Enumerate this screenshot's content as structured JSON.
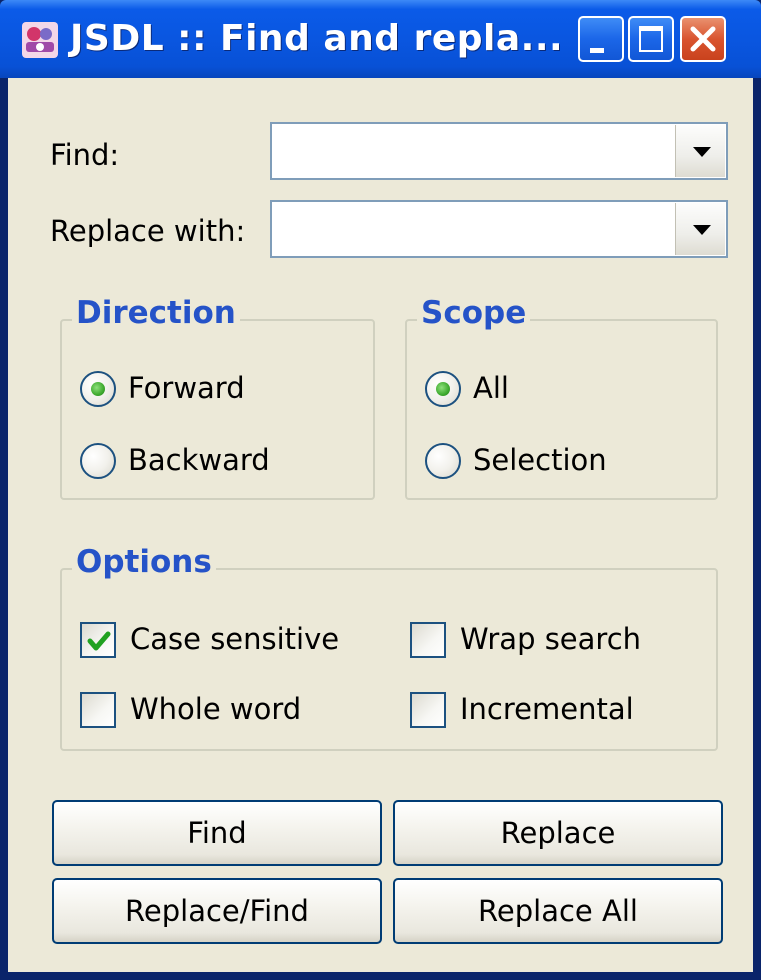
{
  "window": {
    "title": "JSDL :: Find and repla...",
    "buttons": {
      "minimize": "minimize",
      "maximize": "maximize",
      "close": "close"
    }
  },
  "form": {
    "find_label": "Find:",
    "find_value": "",
    "replace_label": "Replace with:",
    "replace_value": ""
  },
  "direction": {
    "title": "Direction",
    "options": [
      {
        "label": "Forward",
        "selected": true
      },
      {
        "label": "Backward",
        "selected": false
      }
    ]
  },
  "scope": {
    "title": "Scope",
    "options": [
      {
        "label": "All",
        "selected": true
      },
      {
        "label": "Selection",
        "selected": false
      }
    ]
  },
  "options": {
    "title": "Options",
    "items": [
      {
        "label": "Case sensitive",
        "checked": true
      },
      {
        "label": "Wrap search",
        "checked": false
      },
      {
        "label": "Whole word",
        "checked": false
      },
      {
        "label": "Incremental",
        "checked": false
      }
    ]
  },
  "actions": {
    "find": "Find",
    "replace": "Replace",
    "replace_find": "Replace/Find",
    "replace_all": "Replace All"
  },
  "colors": {
    "titlebar": "#0a56e0",
    "client_bg": "#ece9d8",
    "group_title": "#2553c8",
    "radio_selected": "#3eaa2f",
    "check_mark": "#21a121",
    "close_button": "#d9542f"
  },
  "icons": {
    "app": "jsdl-app-icon",
    "combo_arrow": "chevron-down-icon",
    "checkmark": "checkmark-icon"
  }
}
